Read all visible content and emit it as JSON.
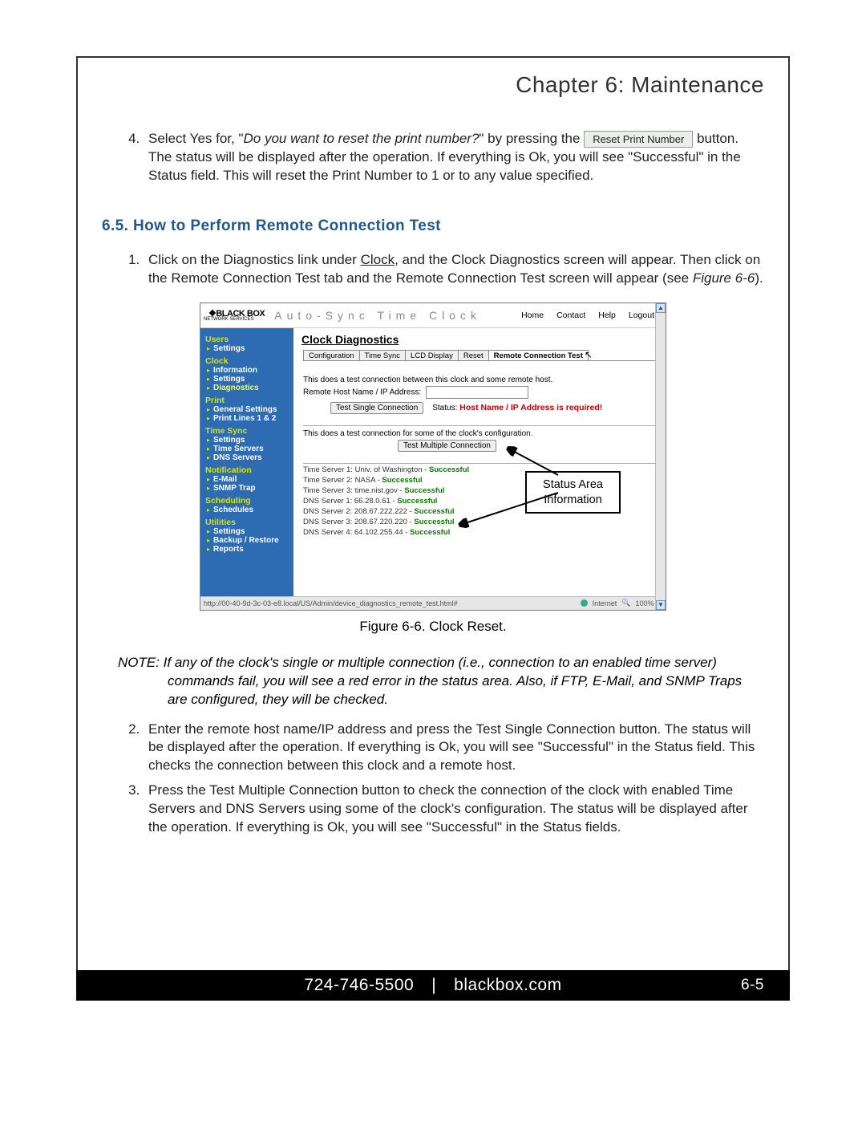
{
  "header": {
    "chapter": "Chapter 6: Maintenance"
  },
  "step4": {
    "prefix": "Select Yes for, \"",
    "question": "Do you want to reset the print number?",
    "between": "\" by pressing the ",
    "button_label": "Reset Print Number",
    "tail": " button. The status will be displayed after the operation. If everything is Ok, you will see \"Successful\" in the Status field. This will reset the Print Number to 1 or to any value specified."
  },
  "section_heading": "6.5.    How to Perform Remote Connection Test",
  "step1": {
    "pre": "Click on the Diagnostics link under ",
    "ul_word": "Clock",
    "mid": ", and the Clock Diagnostics screen will appear. Then click on the Remote Connection Test tab and the Remote Connection Test screen will appear (see ",
    "figref": "Figure 6-6",
    "tail": ")."
  },
  "screenshot": {
    "logo_main": "❖BLACK BOX",
    "logo_sub": "NETWORK SERVICES",
    "app_title": "Auto-Sync Time Clock",
    "header_links": [
      "Home",
      "Contact",
      "Help",
      "Logout"
    ],
    "nav": [
      {
        "head": "Users",
        "items": [
          "Settings"
        ]
      },
      {
        "head": "Clock",
        "items": [
          "Information",
          "Settings",
          "Diagnostics"
        ],
        "selected": 2
      },
      {
        "head": "Print",
        "items": [
          "General Settings",
          "Print Lines 1 & 2"
        ]
      },
      {
        "head": "Time Sync",
        "items": [
          "Settings",
          "Time Servers",
          "DNS Servers"
        ]
      },
      {
        "head": "Notification",
        "items": [
          "E-Mail",
          "SNMP Trap"
        ]
      },
      {
        "head": "Scheduling",
        "items": [
          "Schedules"
        ]
      },
      {
        "head": "Utilities",
        "items": [
          "Settings",
          "Backup / Restore",
          "Reports"
        ]
      }
    ],
    "main_title": "Clock Diagnostics",
    "tabs": [
      "Configuration",
      "Time Sync",
      "LCD Display",
      "Reset",
      "Remote Connection Test"
    ],
    "active_tab": 4,
    "desc1": "This does a test connection between this clock and some remote host.",
    "label_ip": "Remote Host Name / IP Address:",
    "btn_single": "Test Single Connection",
    "status_label": "Status:",
    "status_msg": "Host Name / IP Address is required!",
    "desc2": "This does a test connection for some of the clock's configuration.",
    "btn_multi": "Test Multiple Connection",
    "results": [
      {
        "label": "Time Server 1: Univ. of Washington - ",
        "status": "Successful"
      },
      {
        "label": "Time Server 2: NASA - ",
        "status": "Successful"
      },
      {
        "label": "Time Server 3: time.nist.gov - ",
        "status": "Successful"
      },
      {
        "label": "DNS Server 1: 66.28.0.61 - ",
        "status": "Successful"
      },
      {
        "label": "DNS Server 2: 208.67.222.222 - ",
        "status": "Successful"
      },
      {
        "label": "DNS Server 3: 208.67.220.220 - ",
        "status": "Successful"
      },
      {
        "label": "DNS Server 4: 64.102.255.44 - ",
        "status": "Successful"
      }
    ],
    "status_url": "http://00-40-9d-3c-03-e8.local/US/Admin/device_diagnostics_remote_test.html#",
    "status_net": "Internet",
    "status_zoom": "100%",
    "callout": "Status Area\nInformation"
  },
  "fig_caption": "Figure 6-6.  Clock Reset.",
  "note": {
    "lead": "NOTE:",
    "body": " If any of the clock's single or multiple connection (i.e., connection to an enabled time server) commands fail, you will see a red error in the status area. Also, if FTP, E-Mail, and SNMP Traps are configured, they will be checked."
  },
  "step2": "Enter the remote host name/IP address and press the Test Single Connection button. The status will be displayed after the operation. If everything is Ok, you will see \"Successful\" in the Status field. This checks the connection between this clock and a remote host.",
  "step3": "Press the Test Multiple Connection button to check the connection of the clock with enabled Time Servers and DNS Servers using some of the clock's configuration. The status will be displayed after the operation. If everything is Ok, you will see \"Successful\" in the Status fields.",
  "footer": {
    "phone": "724-746-5500",
    "sep": "|",
    "site": "blackbox.com",
    "page": "6-5"
  }
}
